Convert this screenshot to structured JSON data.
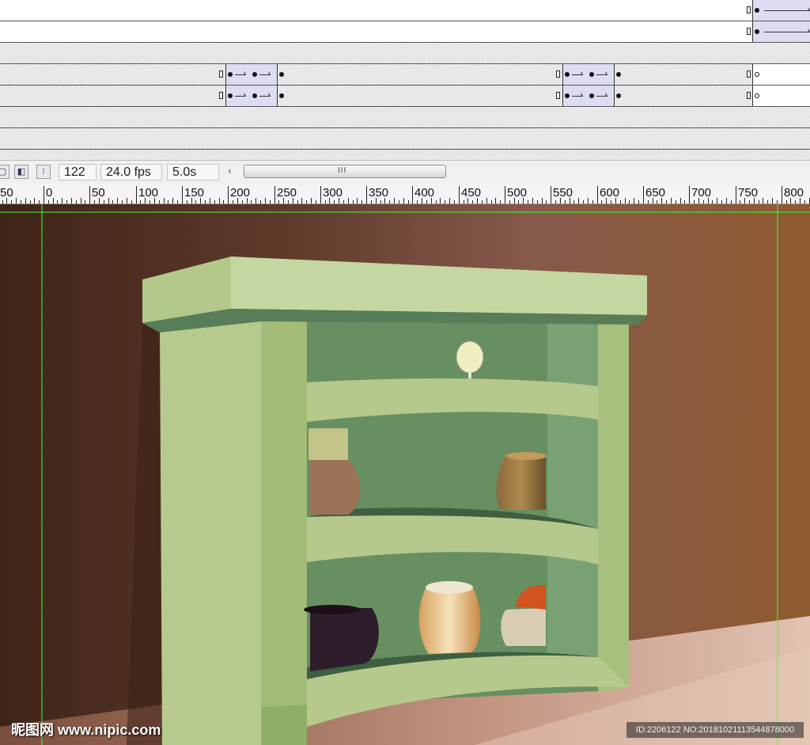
{
  "status": {
    "frame": "122",
    "fps": "24.0 fps",
    "time": "5.0s",
    "scroll_left_glyph": "‹",
    "scroll_grip_glyph": "III"
  },
  "toolbar_icons": [
    "onion-skin-icon",
    "onion-outline-icon",
    "edit-multiple-frames-icon"
  ],
  "ruler_labels": [
    "50",
    "0",
    "50",
    "100",
    "150",
    "200",
    "250",
    "300",
    "350",
    "400",
    "450",
    "500",
    "550",
    "600",
    "650",
    "700",
    "750",
    "800"
  ],
  "watermark": "昵图网 www.nipic.com",
  "image_id": "ID:2206122 NO:20181021113544878000",
  "colors": {
    "cabinet": "#b6c98c",
    "cabinet_shadow": "#4f7550",
    "wall": "#7a4c38",
    "floor": "#d8b8a2",
    "guide": "#3aff3a",
    "tween": "#dcdcf2"
  }
}
